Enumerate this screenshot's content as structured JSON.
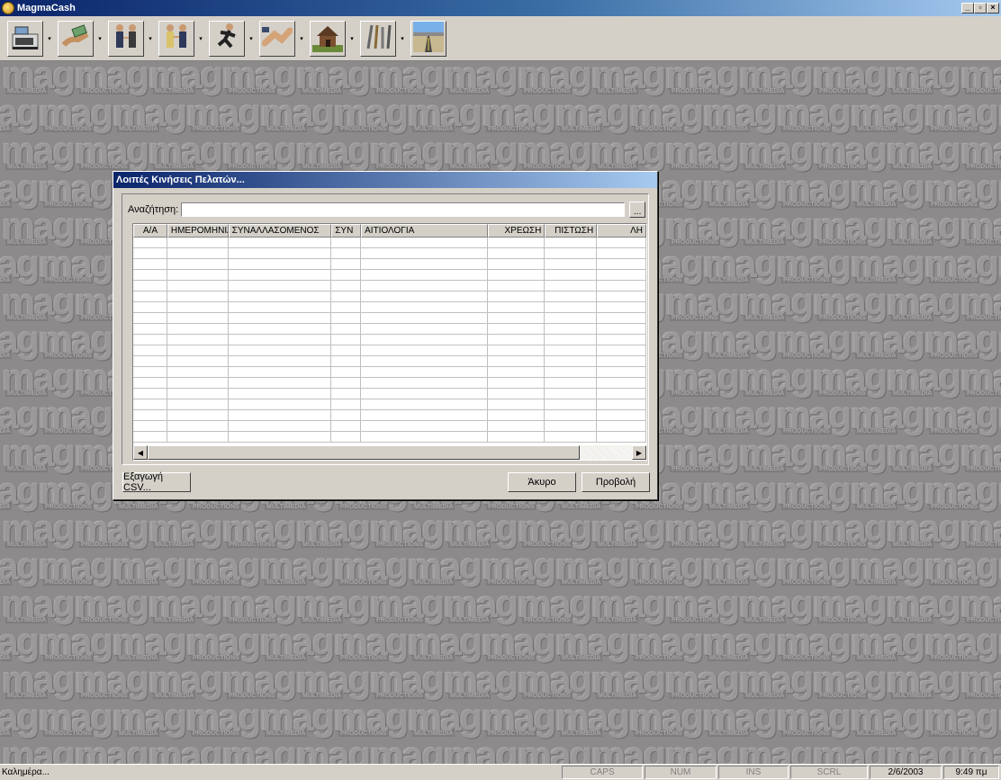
{
  "window": {
    "title": "MagmaCash",
    "minimize": "_",
    "restore": "▫",
    "close": "×"
  },
  "toolbar": {
    "tools": [
      {
        "name": "cash-register-icon",
        "has_dropdown": true
      },
      {
        "name": "money-hand-icon",
        "has_dropdown": true
      },
      {
        "name": "business-people-icon",
        "has_dropdown": true
      },
      {
        "name": "handshake-people-icon",
        "has_dropdown": true
      },
      {
        "name": "running-man-icon",
        "has_dropdown": true
      },
      {
        "name": "handshake-icon",
        "has_dropdown": true
      },
      {
        "name": "house-icon",
        "has_dropdown": true
      },
      {
        "name": "tools-icon",
        "has_dropdown": true
      },
      {
        "name": "road-icon",
        "has_dropdown": false
      }
    ],
    "dropdown_glyph": "▾"
  },
  "background": {
    "word": "magma",
    "sublabels": [
      "MULTIMEDIA",
      "PRODUCTIONS"
    ]
  },
  "dialog": {
    "title": "Λοιπές Κινήσεις Πελατών...",
    "search_label": "Αναζήτηση:",
    "search_value": "",
    "browse_label": "...",
    "columns": [
      "Α/Α",
      "ΗΜΕΡΟΜΗΝΙΑ",
      "ΣΥΝΑΛΛΑΣΟΜΕΝΟΣ",
      "ΣΥΝ",
      "ΑΙΤΙΟΛΟΓΙΑ",
      "ΧΡΕΩΣΗ",
      "ΠΙΣΤΩΣΗ",
      "ΛΗ"
    ],
    "row_count": 19,
    "scroll_left": "◀",
    "scroll_right": "▶",
    "export_label": "Εξαγωγή CSV...",
    "cancel_label": "Άκυρο",
    "view_label": "Προβολή"
  },
  "statusbar": {
    "message": "Καλημέρα...",
    "caps": "CAPS",
    "num": "NUM",
    "ins": "INS",
    "scrl": "SCRL",
    "date": "2/6/2003",
    "time": "9:49 πμ"
  }
}
